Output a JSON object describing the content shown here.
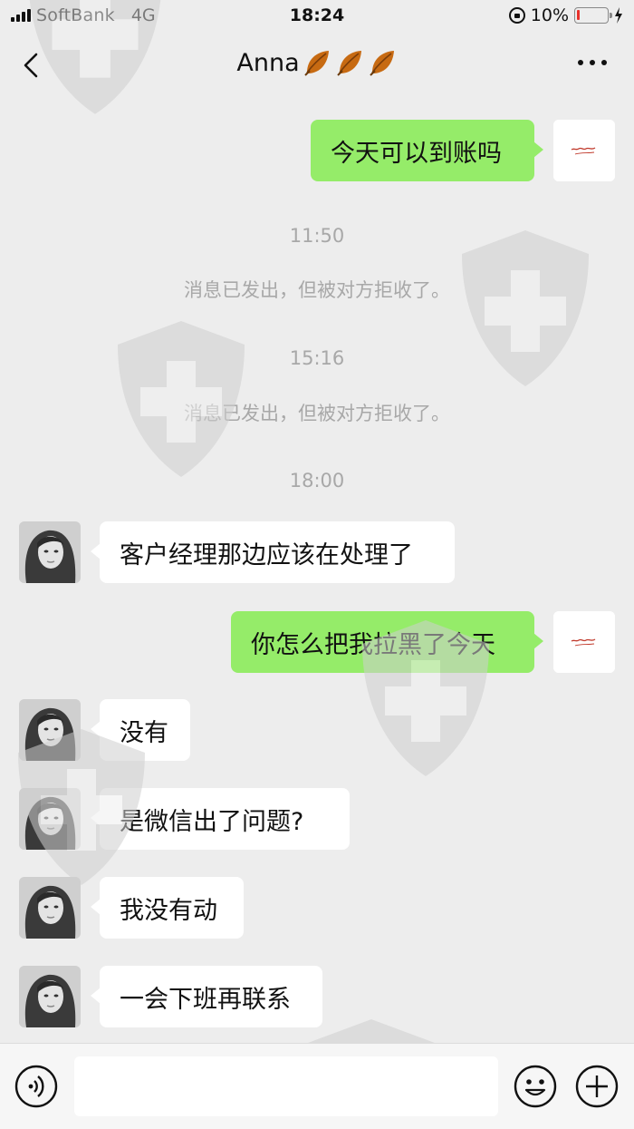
{
  "status_bar": {
    "carrier": "SoftBank",
    "network": "4G",
    "time": "18:24",
    "battery_level": "10%",
    "battery_fraction": 0.1
  },
  "nav": {
    "title": "Anna",
    "title_emoji": [
      "fallen-leaf-icon",
      "fallen-leaf-icon",
      "fallen-leaf-icon"
    ],
    "back_icon": "chevron-left-icon",
    "more_icon": "more-dots-icon"
  },
  "chat": {
    "msg_1": "今天可以到账吗",
    "ts_1": "11:50",
    "sys_1": "消息已发出，但被对方拒收了。",
    "ts_2": "15:16",
    "sys_2": "消息已发出，但被对方拒收了。",
    "ts_3": "18:00",
    "msg_2": "客户经理那边应该在处理了",
    "msg_3": "你怎么把我拉黑了今天",
    "msg_4": "没有",
    "msg_5": "是微信出了问题?",
    "msg_6": "我没有动",
    "msg_7": "一会下班再联系"
  },
  "input_bar": {
    "value": "",
    "voice_icon": "voice-icon",
    "emoji_icon": "emoji-icon",
    "plus_icon": "plus-icon"
  },
  "colors": {
    "background": "#ededed",
    "bubble_me": "#95ec69",
    "bubble_them": "#ffffff",
    "timestamp": "#a8a8a8",
    "battery_low": "#e8302a"
  }
}
